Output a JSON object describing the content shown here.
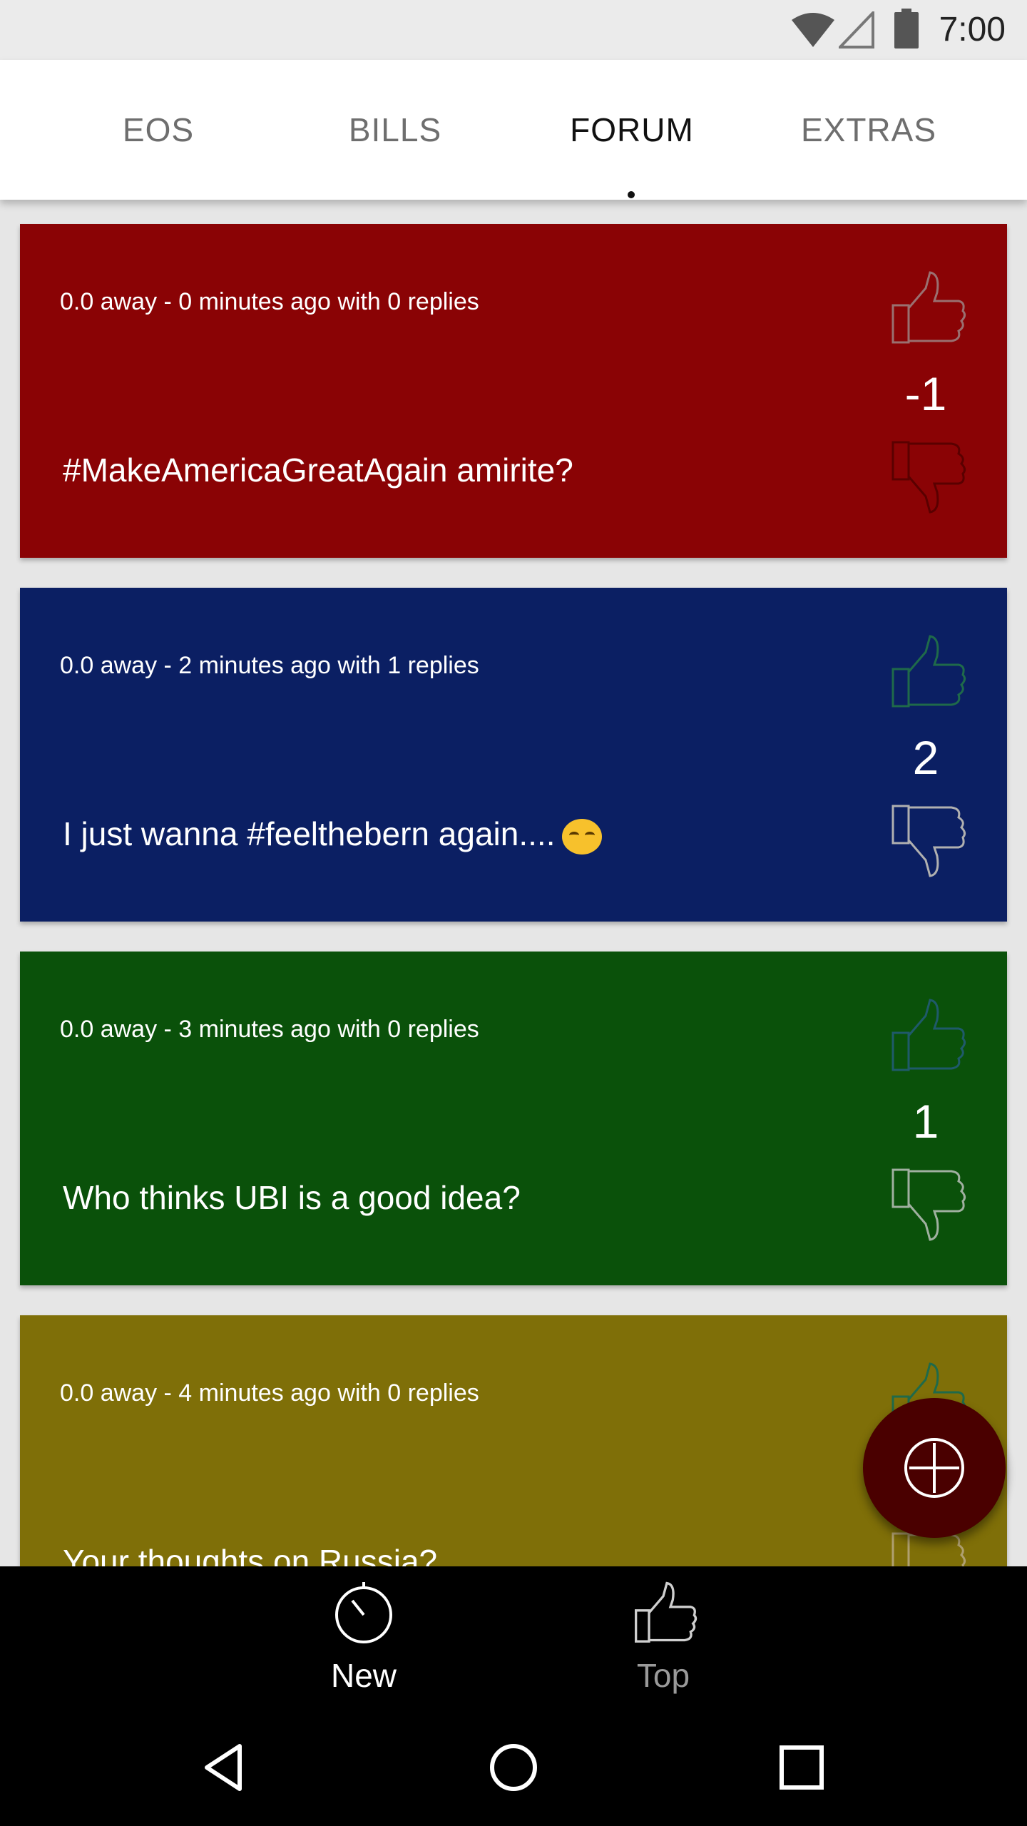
{
  "status_bar": {
    "time": "7:00",
    "icons": [
      "wifi-icon",
      "signal-icon",
      "battery-icon"
    ]
  },
  "tabs": [
    {
      "label": "EOS",
      "active": false
    },
    {
      "label": "BILLS",
      "active": false
    },
    {
      "label": "FORUM",
      "active": true
    },
    {
      "label": "EXTRAS",
      "active": false
    }
  ],
  "posts": [
    {
      "meta": "0.0 away -  0 minutes ago with 0 replies",
      "title": "#MakeAmericaGreatAgain amirite?",
      "score": "-1",
      "color": "#8a0305",
      "vote": "down"
    },
    {
      "meta": "0.0 away -  2 minutes ago with 1 replies",
      "title": "I just wanna #feelthebern again....",
      "score": "2",
      "color": "#0b1f63",
      "vote": "up",
      "emoji": "persevering-face-emoji"
    },
    {
      "meta": "0.0 away -  3 minutes ago with 0 replies",
      "title": "Who thinks UBI is a good idea?",
      "score": "1",
      "color": "#0a510a",
      "vote": "up"
    },
    {
      "meta": "0.0 away -  4 minutes ago with 0 replies",
      "title": "Your thoughts on Russia?",
      "score": "",
      "color": "#7f6f08",
      "vote": "none"
    }
  ],
  "fab": {
    "icon": "crosshair-icon"
  },
  "bottom_nav": [
    {
      "label": "New",
      "icon": "timer-icon",
      "active": true
    },
    {
      "label": "Top",
      "icon": "thumbs-up-icon",
      "active": false
    }
  ],
  "system_nav": [
    "back-icon",
    "home-icon",
    "recents-icon"
  ]
}
